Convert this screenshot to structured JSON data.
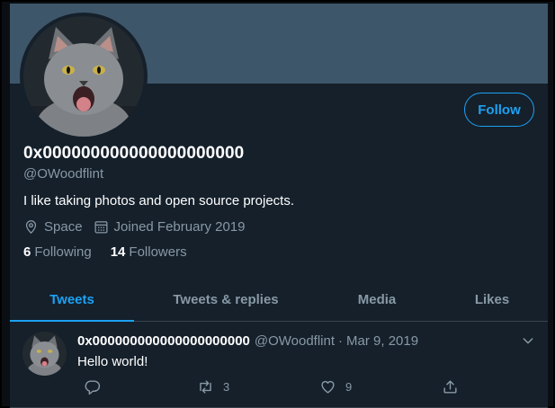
{
  "profile": {
    "display_name": "0x000000000000000000000",
    "handle": "@OWoodflint",
    "bio": "I like taking photos and open source projects.",
    "location": "Space",
    "joined": "Joined February 2019",
    "following_count": "6",
    "following_label": "Following",
    "followers_count": "14",
    "followers_label": "Followers",
    "follow_label": "Follow"
  },
  "tabs": [
    {
      "label": "Tweets",
      "active": true
    },
    {
      "label": "Tweets & replies",
      "active": false
    },
    {
      "label": "Media",
      "active": false
    },
    {
      "label": "Likes",
      "active": false
    }
  ],
  "tweet": {
    "author_name": "0x000000000000000000000",
    "author_handle": "@OWoodflint",
    "separator": "·",
    "date": "Mar 9, 2019",
    "text": "Hello world!",
    "retweets": "3",
    "likes": "9"
  },
  "icons": {
    "location": "map-pin-icon",
    "calendar": "calendar-icon",
    "reply": "reply-icon",
    "retweet": "retweet-icon",
    "like": "heart-icon",
    "share": "share-icon",
    "more": "chevron-down-icon"
  },
  "colors": {
    "background": "#15202b",
    "banner": "#3e5669",
    "accent": "#1da1f2",
    "secondary_text": "#8899a6",
    "divider": "#38444d"
  }
}
